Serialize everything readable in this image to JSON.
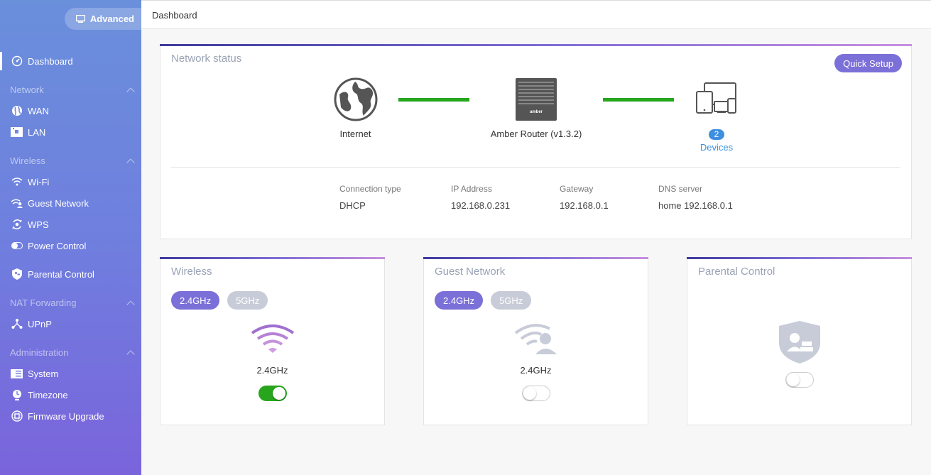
{
  "sidebar": {
    "advanced_label": "Advanced",
    "items": {
      "dashboard": "Dashboard",
      "wan": "WAN",
      "lan": "LAN",
      "wifi": "Wi-Fi",
      "guest": "Guest Network",
      "wps": "WPS",
      "power": "Power Control",
      "parental": "Parental Control",
      "upnp": "UPnP",
      "system": "System",
      "timezone": "Timezone",
      "firmware": "Firmware Upgrade"
    },
    "groups": {
      "network": "Network",
      "wireless": "Wireless",
      "nat": "NAT Forwarding",
      "admin": "Administration"
    }
  },
  "header": {
    "breadcrumb": "Dashboard"
  },
  "network_status": {
    "title": "Network status",
    "quick_setup": "Quick Setup",
    "internet_label": "Internet",
    "router_label": "Amber Router (v1.3.2)",
    "router_brand": "amber",
    "device_count": "2",
    "devices_label": "Devices",
    "info": [
      {
        "label": "Connection type",
        "value": "DHCP"
      },
      {
        "label": "IP Address",
        "value": "192.168.0.231"
      },
      {
        "label": "Gateway",
        "value": "192.168.0.1"
      },
      {
        "label": "DNS server",
        "value": "home 192.168.0.1"
      }
    ]
  },
  "wireless_card": {
    "title": "Wireless",
    "band_24": "2.4GHz",
    "band_5": "5GHz",
    "selected_band_label": "2.4GHz",
    "enabled": true
  },
  "guest_card": {
    "title": "Guest Network",
    "band_24": "2.4GHz",
    "band_5": "5GHz",
    "selected_band_label": "2.4GHz",
    "enabled": false
  },
  "parental_card": {
    "title": "Parental Control",
    "enabled": false
  },
  "colors": {
    "accent": "#7b6fd8",
    "link_green": "#27a61d",
    "badge_blue": "#3d8fe0"
  }
}
